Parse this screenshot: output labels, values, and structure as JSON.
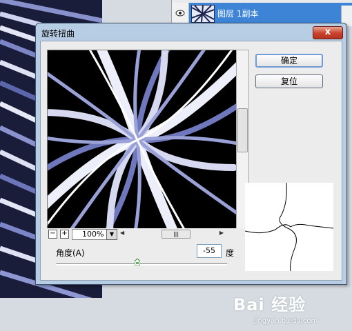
{
  "layers_panel": {
    "layer_name": "图层 1副本"
  },
  "dialog": {
    "title": "旋转扭曲",
    "close_symbol": "x",
    "ok_label": "确定",
    "reset_label": "复位",
    "zoom_minus": "−",
    "zoom_plus": "+",
    "zoom_value": "100%",
    "angle_label": "角度(A)",
    "angle_value": "-55",
    "angle_unit": "度"
  },
  "watermark": {
    "logo": "Bai 经验",
    "url": "jingyan.baidu.com"
  },
  "icons": [
    "eye-icon",
    "close-icon",
    "zoom-out-icon",
    "zoom-in-icon",
    "dropdown-arrow-icon",
    "slider-thumb-icon"
  ],
  "colors": {
    "swirl_dark": "#000000",
    "swirl_light": "#e8eaf6",
    "swirl_blue": "#6b76b6",
    "layer_highlight": "#3d83d6"
  }
}
